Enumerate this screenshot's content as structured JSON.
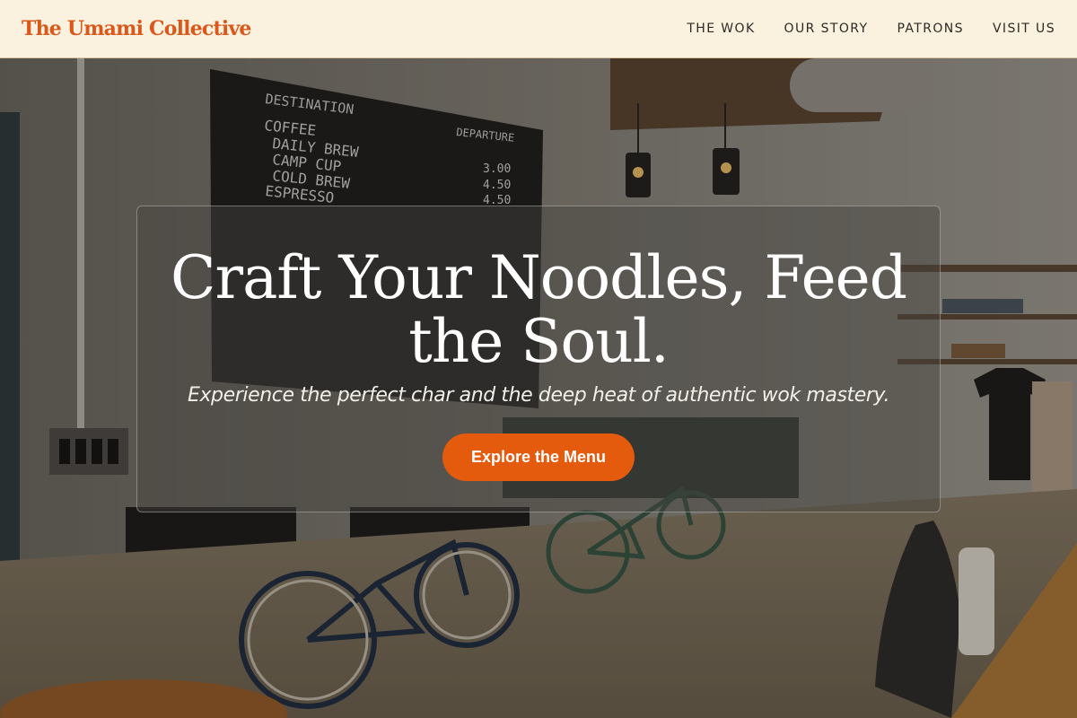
{
  "header": {
    "brand": "The Umami Collective",
    "nav": [
      {
        "label": "THE WOK"
      },
      {
        "label": "OUR STORY"
      },
      {
        "label": "PATRONS"
      },
      {
        "label": "VISIT US"
      }
    ]
  },
  "hero": {
    "headline": "Craft Your Noodles, Feed the Soul.",
    "tagline": "Experience the perfect char and the deep heat of authentic wok mastery.",
    "cta_label": "Explore the Menu",
    "background_image": {
      "board_title": "DESTINATION",
      "board_col2": "DEPARTURE",
      "board_items": [
        "COFFEE",
        "DAILY BREW",
        "CAMP CUP",
        "COLD BREW",
        "ESPRESSO"
      ],
      "board_prices": [
        "3.00",
        "4.50",
        "4.50"
      ]
    }
  },
  "colors": {
    "brand": "#d9581a",
    "header_bg": "#faf1df",
    "cta_bg": "#e55b0e",
    "text_light": "#ffffff"
  }
}
